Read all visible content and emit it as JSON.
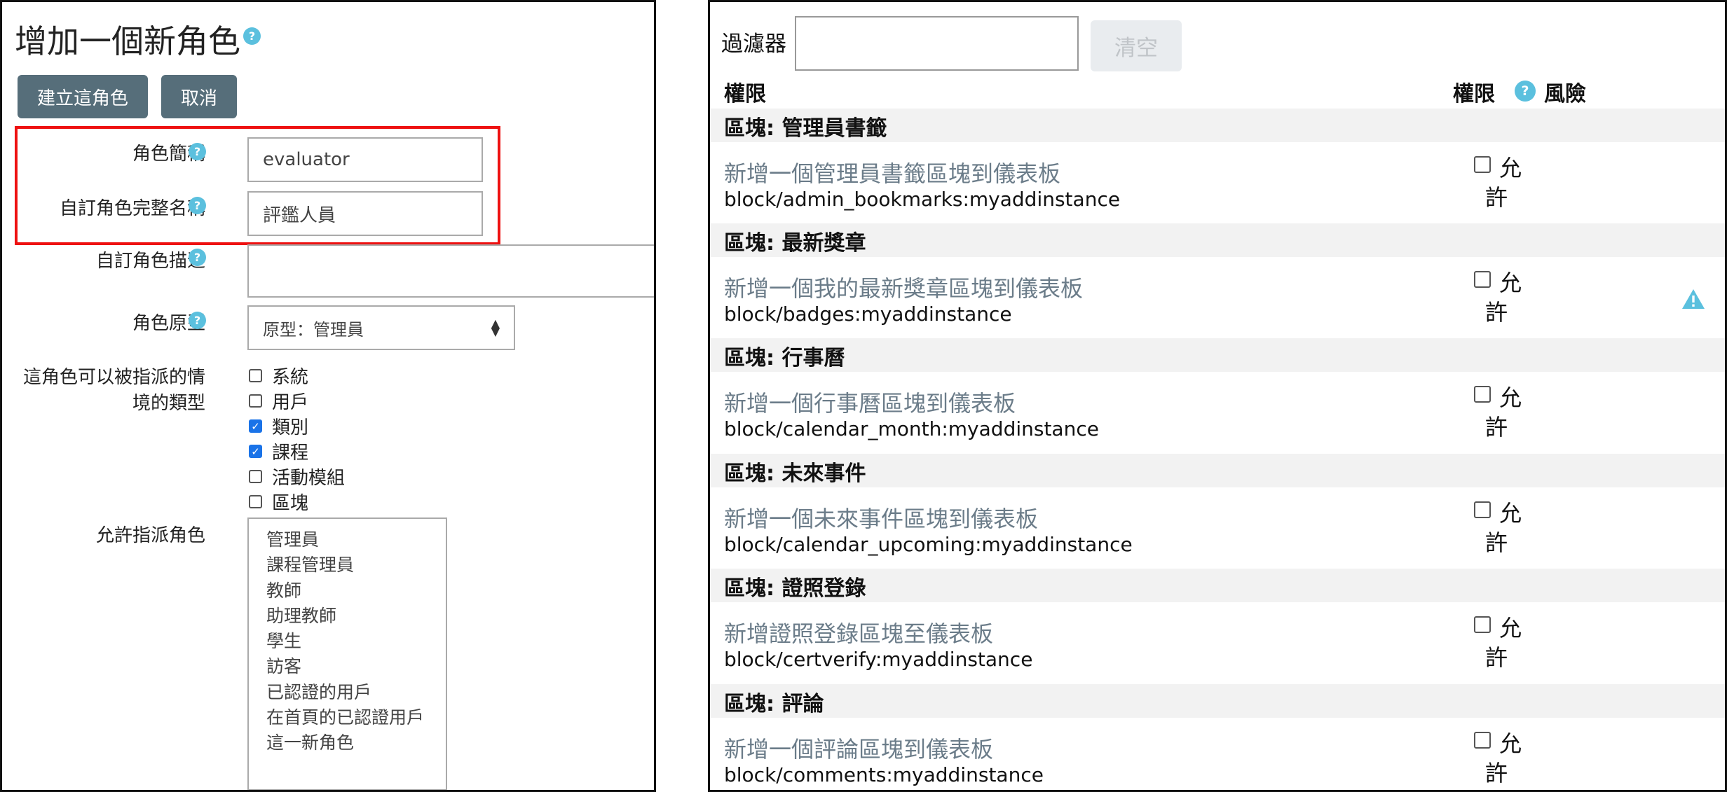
{
  "left": {
    "title": "增加一個新角色",
    "buttons": {
      "create": "建立這角色",
      "cancel": "取消"
    },
    "fields": {
      "short_name_label": "角色簡稱",
      "short_name_value": "evaluator",
      "full_name_label": "自訂角色完整名稱",
      "full_name_value": "評鑑人員",
      "description_label": "自訂角色描述",
      "description_value": "",
      "archetype_label": "角色原型",
      "archetype_value": "原型：管理員"
    },
    "context_label_line1": "這角色可以被指派的情",
    "context_label_line2": "境的類型",
    "contexts": [
      {
        "label": "系統",
        "checked": false
      },
      {
        "label": "用戶",
        "checked": false
      },
      {
        "label": "類別",
        "checked": true
      },
      {
        "label": "課程",
        "checked": true
      },
      {
        "label": "活動模組",
        "checked": false
      },
      {
        "label": "區塊",
        "checked": false
      }
    ],
    "allow_assign_label": "允許指派角色",
    "allow_assign_roles": [
      "管理員",
      "課程管理員",
      "教師",
      "助理教師",
      "學生",
      "訪客",
      "已認證的用戶",
      "在首頁的已認證用戶",
      "這一新角色"
    ]
  },
  "right": {
    "filter_label": "過濾器",
    "filter_value": "",
    "clear_button": "清空",
    "header_capability": "權限",
    "header_permission": "權限",
    "header_risk": "風險",
    "allow_line1": "允",
    "allow_line2": "許",
    "sections": [
      {
        "title": "區塊: 管理員書籤",
        "link": "新增一個管理員書籤區塊到儀表板",
        "capability": "block/admin_bookmarks:myaddinstance",
        "allowed": false,
        "risk": ""
      },
      {
        "title": "區塊: 最新獎章",
        "link": "新增一個我的最新獎章區塊到儀表板",
        "capability": "block/badges:myaddinstance",
        "allowed": false,
        "risk": "warning-icon"
      },
      {
        "title": "區塊: 行事曆",
        "link": "新增一個行事曆區塊到儀表板",
        "capability": "block/calendar_month:myaddinstance",
        "allowed": false,
        "risk": ""
      },
      {
        "title": "區塊: 未來事件",
        "link": "新增一個未來事件區塊到儀表板",
        "capability": "block/calendar_upcoming:myaddinstance",
        "allowed": false,
        "risk": ""
      },
      {
        "title": "區塊: 證照登錄",
        "link": "新增證照登錄區塊至儀表板",
        "capability": "block/certverify:myaddinstance",
        "allowed": false,
        "risk": ""
      },
      {
        "title": "區塊: 評論",
        "link": "新增一個評論區塊到儀表板",
        "capability": "block/comments:myaddinstance",
        "allowed": false,
        "risk": ""
      }
    ]
  },
  "colors": {
    "help_icon": "#5bc0de",
    "button_bg": "#566e7a",
    "highlight_box": "#ee1111",
    "link_text": "#6b7c89",
    "checkbox_checked": "#1a73e8"
  }
}
